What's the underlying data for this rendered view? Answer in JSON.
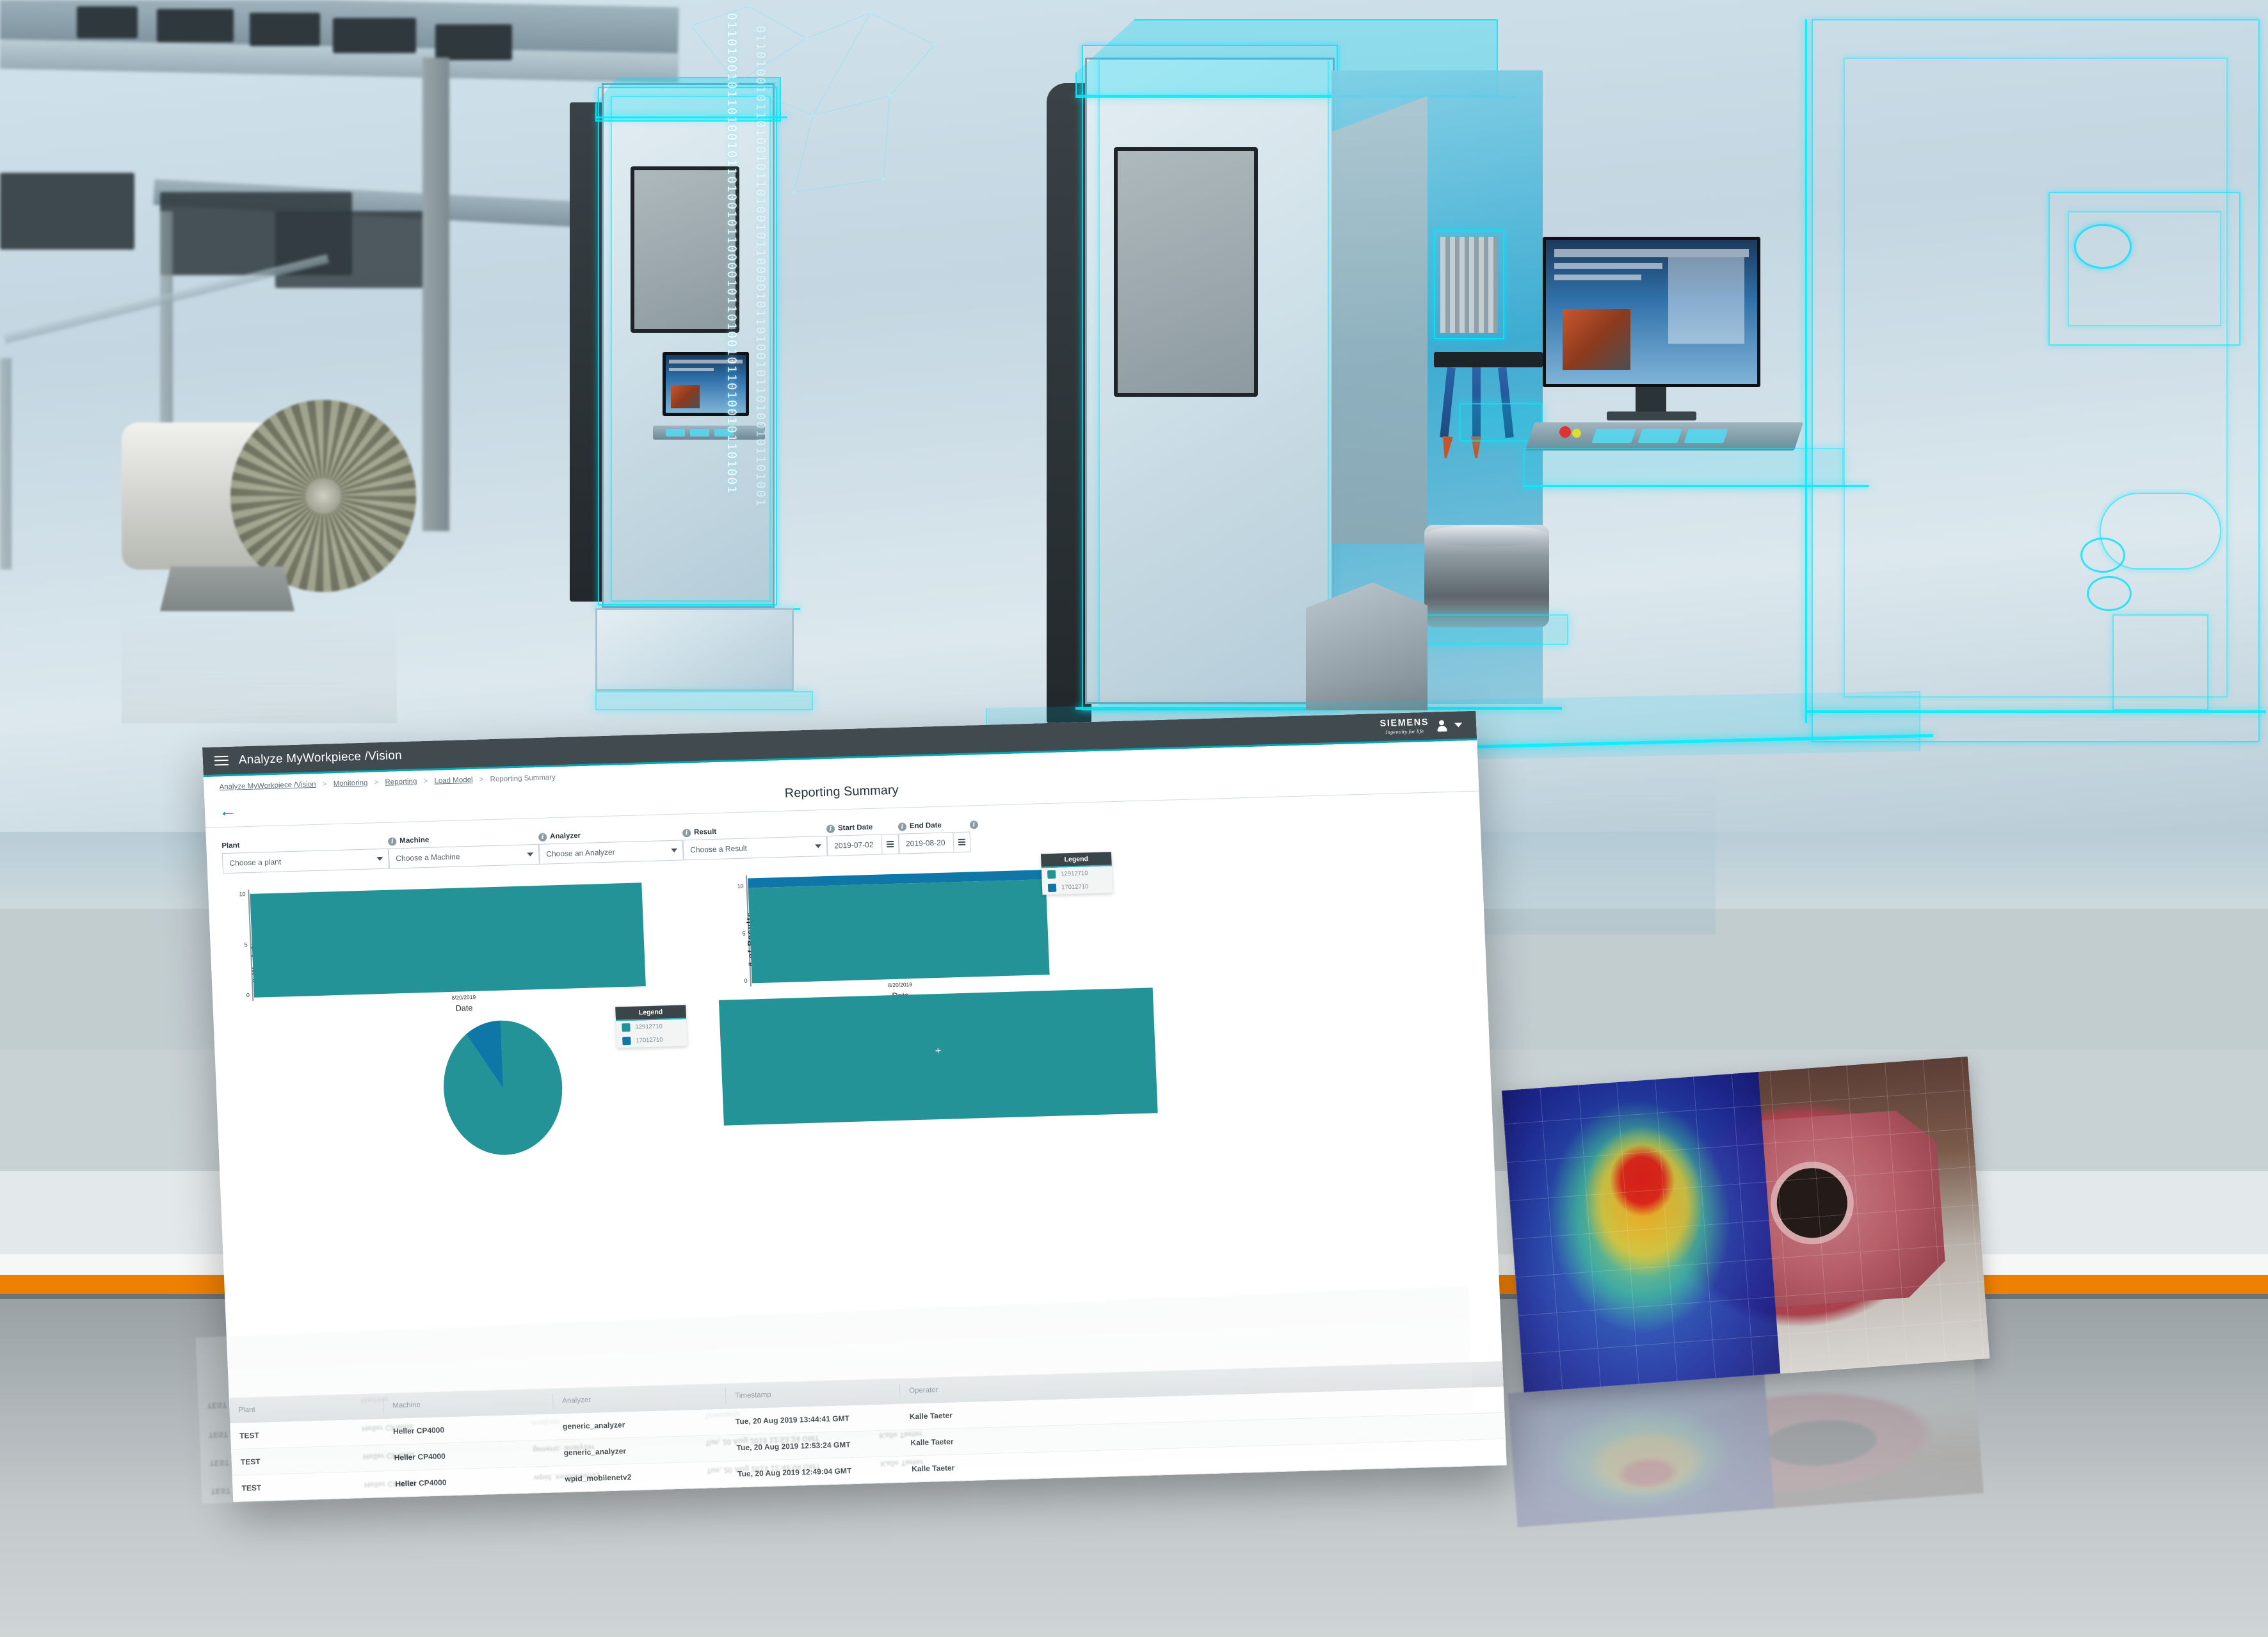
{
  "app": {
    "title": "Analyze MyWorkpiece /Vision",
    "menu_icon": "hamburger-icon",
    "brand": {
      "name": "SIEMENS",
      "tagline": "Ingenuity for life"
    },
    "user_icon": "user-avatar-icon",
    "user_chevron": "chevron-down-icon"
  },
  "breadcrumb": {
    "items": [
      "Analyze MyWorkpiece /Vision",
      "Monitoring",
      "Reporting",
      "Load Model",
      "Reporting Summary"
    ],
    "separator": ">"
  },
  "page": {
    "back_icon": "back-arrow-icon",
    "title": "Reporting Summary"
  },
  "filters": [
    {
      "label": "Plant",
      "info": false,
      "type": "select",
      "value": "Choose a plant"
    },
    {
      "label": "Machine",
      "info": true,
      "type": "select",
      "value": "Choose a Machine"
    },
    {
      "label": "Analyzer",
      "info": true,
      "type": "select",
      "value": "Choose an Analyzer"
    },
    {
      "label": "Result",
      "info": true,
      "type": "select",
      "value": "Choose a Result"
    },
    {
      "label": "Start Date",
      "info": true,
      "type": "date",
      "value": "2019-07-02"
    },
    {
      "label": "End Date",
      "info": true,
      "type": "date",
      "value": "2019-08-20"
    }
  ],
  "colors": {
    "teal": "#239398",
    "dark_blue": "#0f76a8",
    "header_bg": "#404a4f",
    "accent": "#00a7b5",
    "orange": "#f08000"
  },
  "chart_data": [
    {
      "type": "bar",
      "title": "",
      "xlabel": "Date",
      "ylabel": "# Work Items",
      "categories": [
        "8/20/2019"
      ],
      "values": [
        10
      ],
      "ylim": [
        0,
        11
      ],
      "yticks": [
        "0",
        "5",
        "10"
      ],
      "grid": false,
      "legend": null
    },
    {
      "type": "bar",
      "title": "",
      "xlabel": "Date",
      "ylabel": "# of Results",
      "categories": [
        "8/20/2019"
      ],
      "stacked": true,
      "series": [
        {
          "name": "12912710",
          "values": [
            10
          ],
          "color": "#239398"
        },
        {
          "name": "17012710",
          "values": [
            1
          ],
          "color": "#0f76a8"
        }
      ],
      "ylim": [
        0,
        11
      ],
      "yticks": [
        "0",
        "5",
        "10"
      ],
      "grid": false,
      "legend": {
        "title": "Legend",
        "position": "right"
      }
    },
    {
      "type": "pie",
      "title": "",
      "labels": [
        "12912710",
        "17012710"
      ],
      "values": [
        91,
        9
      ],
      "colors": [
        "#239398",
        "#0f76a8"
      ],
      "legend": {
        "title": "Legend",
        "position": "right"
      }
    },
    {
      "type": "bar",
      "title": "",
      "xlabel": "",
      "ylabel": "",
      "categories": [
        ""
      ],
      "values": [
        1
      ],
      "colors": [
        "#239398"
      ],
      "marker": "+"
    }
  ],
  "legend": {
    "title": "Legend"
  },
  "table": {
    "columns": [
      "Plant",
      "Machine",
      "Analyzer",
      "Timestamp",
      "Operator"
    ],
    "rows": [
      {
        "plant": "TEST",
        "machine": "Heller CP4000",
        "analyzer": "generic_analyzer",
        "timestamp": "Tue, 20 Aug 2019 13:44:41 GMT",
        "operator": "Kalle Taeter"
      },
      {
        "plant": "TEST",
        "machine": "Heller CP4000",
        "analyzer": "generic_analyzer",
        "timestamp": "Tue, 20 Aug 2019 12:53:24 GMT",
        "operator": "Kalle Taeter"
      },
      {
        "plant": "TEST",
        "machine": "Heller CP4000",
        "analyzer": "wpid_mobilenetv2",
        "timestamp": "Tue, 20 Aug 2019 12:49:04 GMT",
        "operator": "Kalle Taeter"
      }
    ]
  },
  "scene": {
    "binary": "01101001011010010110100101100001011010010110100101101001",
    "heatmap_label": "workpiece-heatmap"
  }
}
